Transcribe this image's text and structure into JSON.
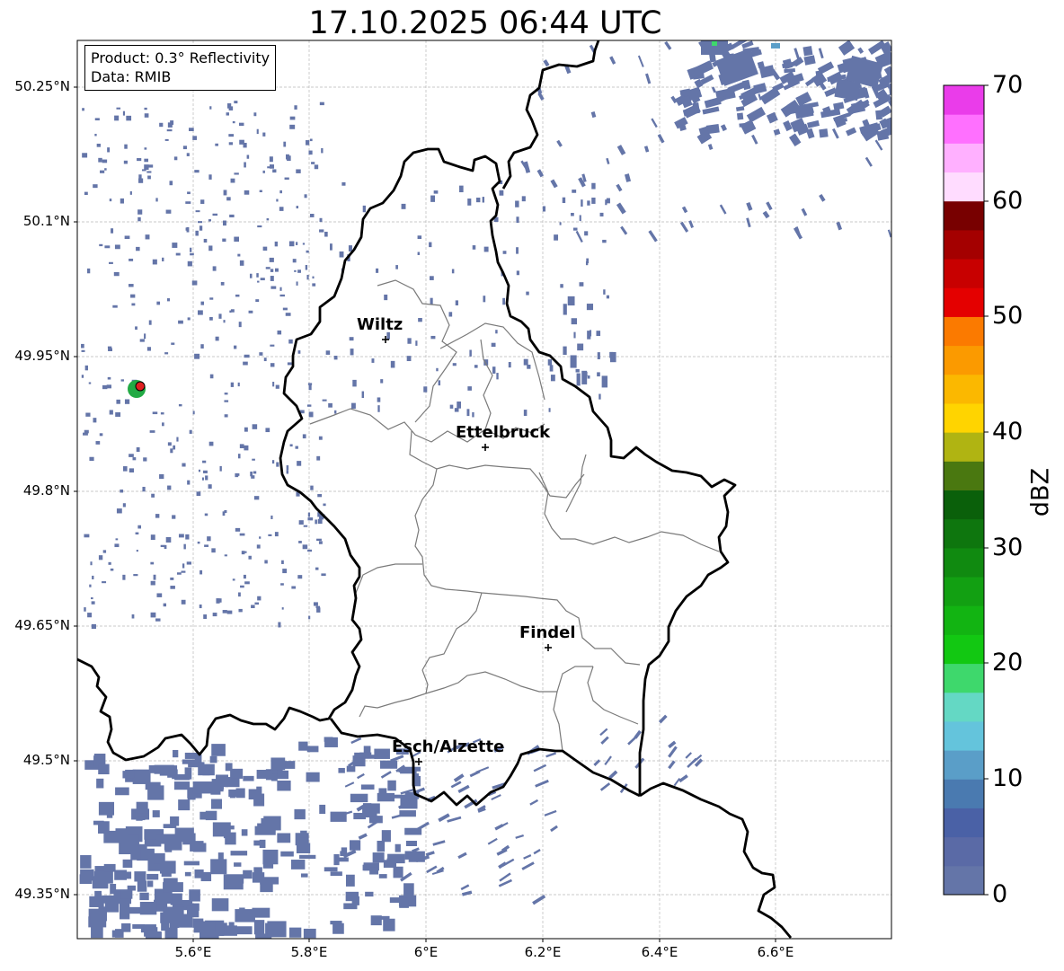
{
  "title": "17.10.2025 06:44 UTC",
  "info": {
    "line1": "Product: 0.3° Reflectivity",
    "line2": "Data: RMIB"
  },
  "axes": {
    "lat_ticks": [
      "50.25°N",
      "50.1°N",
      "49.95°N",
      "49.8°N",
      "49.65°N",
      "49.5°N",
      "49.35°N"
    ],
    "lon_ticks": [
      "5.6°E",
      "5.8°E",
      "6°E",
      "6.2°E",
      "6.4°E",
      "6.6°E"
    ]
  },
  "cities": [
    {
      "name": "Wiltz"
    },
    {
      "name": "Ettelbruck"
    },
    {
      "name": "Findel"
    },
    {
      "name": "Esch/Alzette"
    }
  ],
  "colorbar": {
    "label": "dBZ",
    "ticks": [
      "0",
      "10",
      "20",
      "30",
      "40",
      "50",
      "60",
      "70"
    ],
    "colors": [
      "#6475a8",
      "#5a6aa6",
      "#4a61a6",
      "#4a7ab0",
      "#5a9ec8",
      "#64c4dc",
      "#64d8c4",
      "#3ed86c",
      "#12c812",
      "#12b412",
      "#12a012",
      "#108a10",
      "#0e760e",
      "#0a600a",
      "#4a7810",
      "#b0b412",
      "#ffd400",
      "#fbb800",
      "#fb9a00",
      "#fb7a00",
      "#e40000",
      "#c80000",
      "#a40000",
      "#780000",
      "#ffdcff",
      "#ffb0ff",
      "#ff70ff",
      "#ea3cea"
    ]
  },
  "colors": {
    "echo": "#6475a8",
    "border_country": "#000000",
    "border_canton": "#7a7a7a",
    "grid": "#b0b0b0",
    "radar_site_green": "#22aa44",
    "radar_site_red": "#e02020"
  }
}
